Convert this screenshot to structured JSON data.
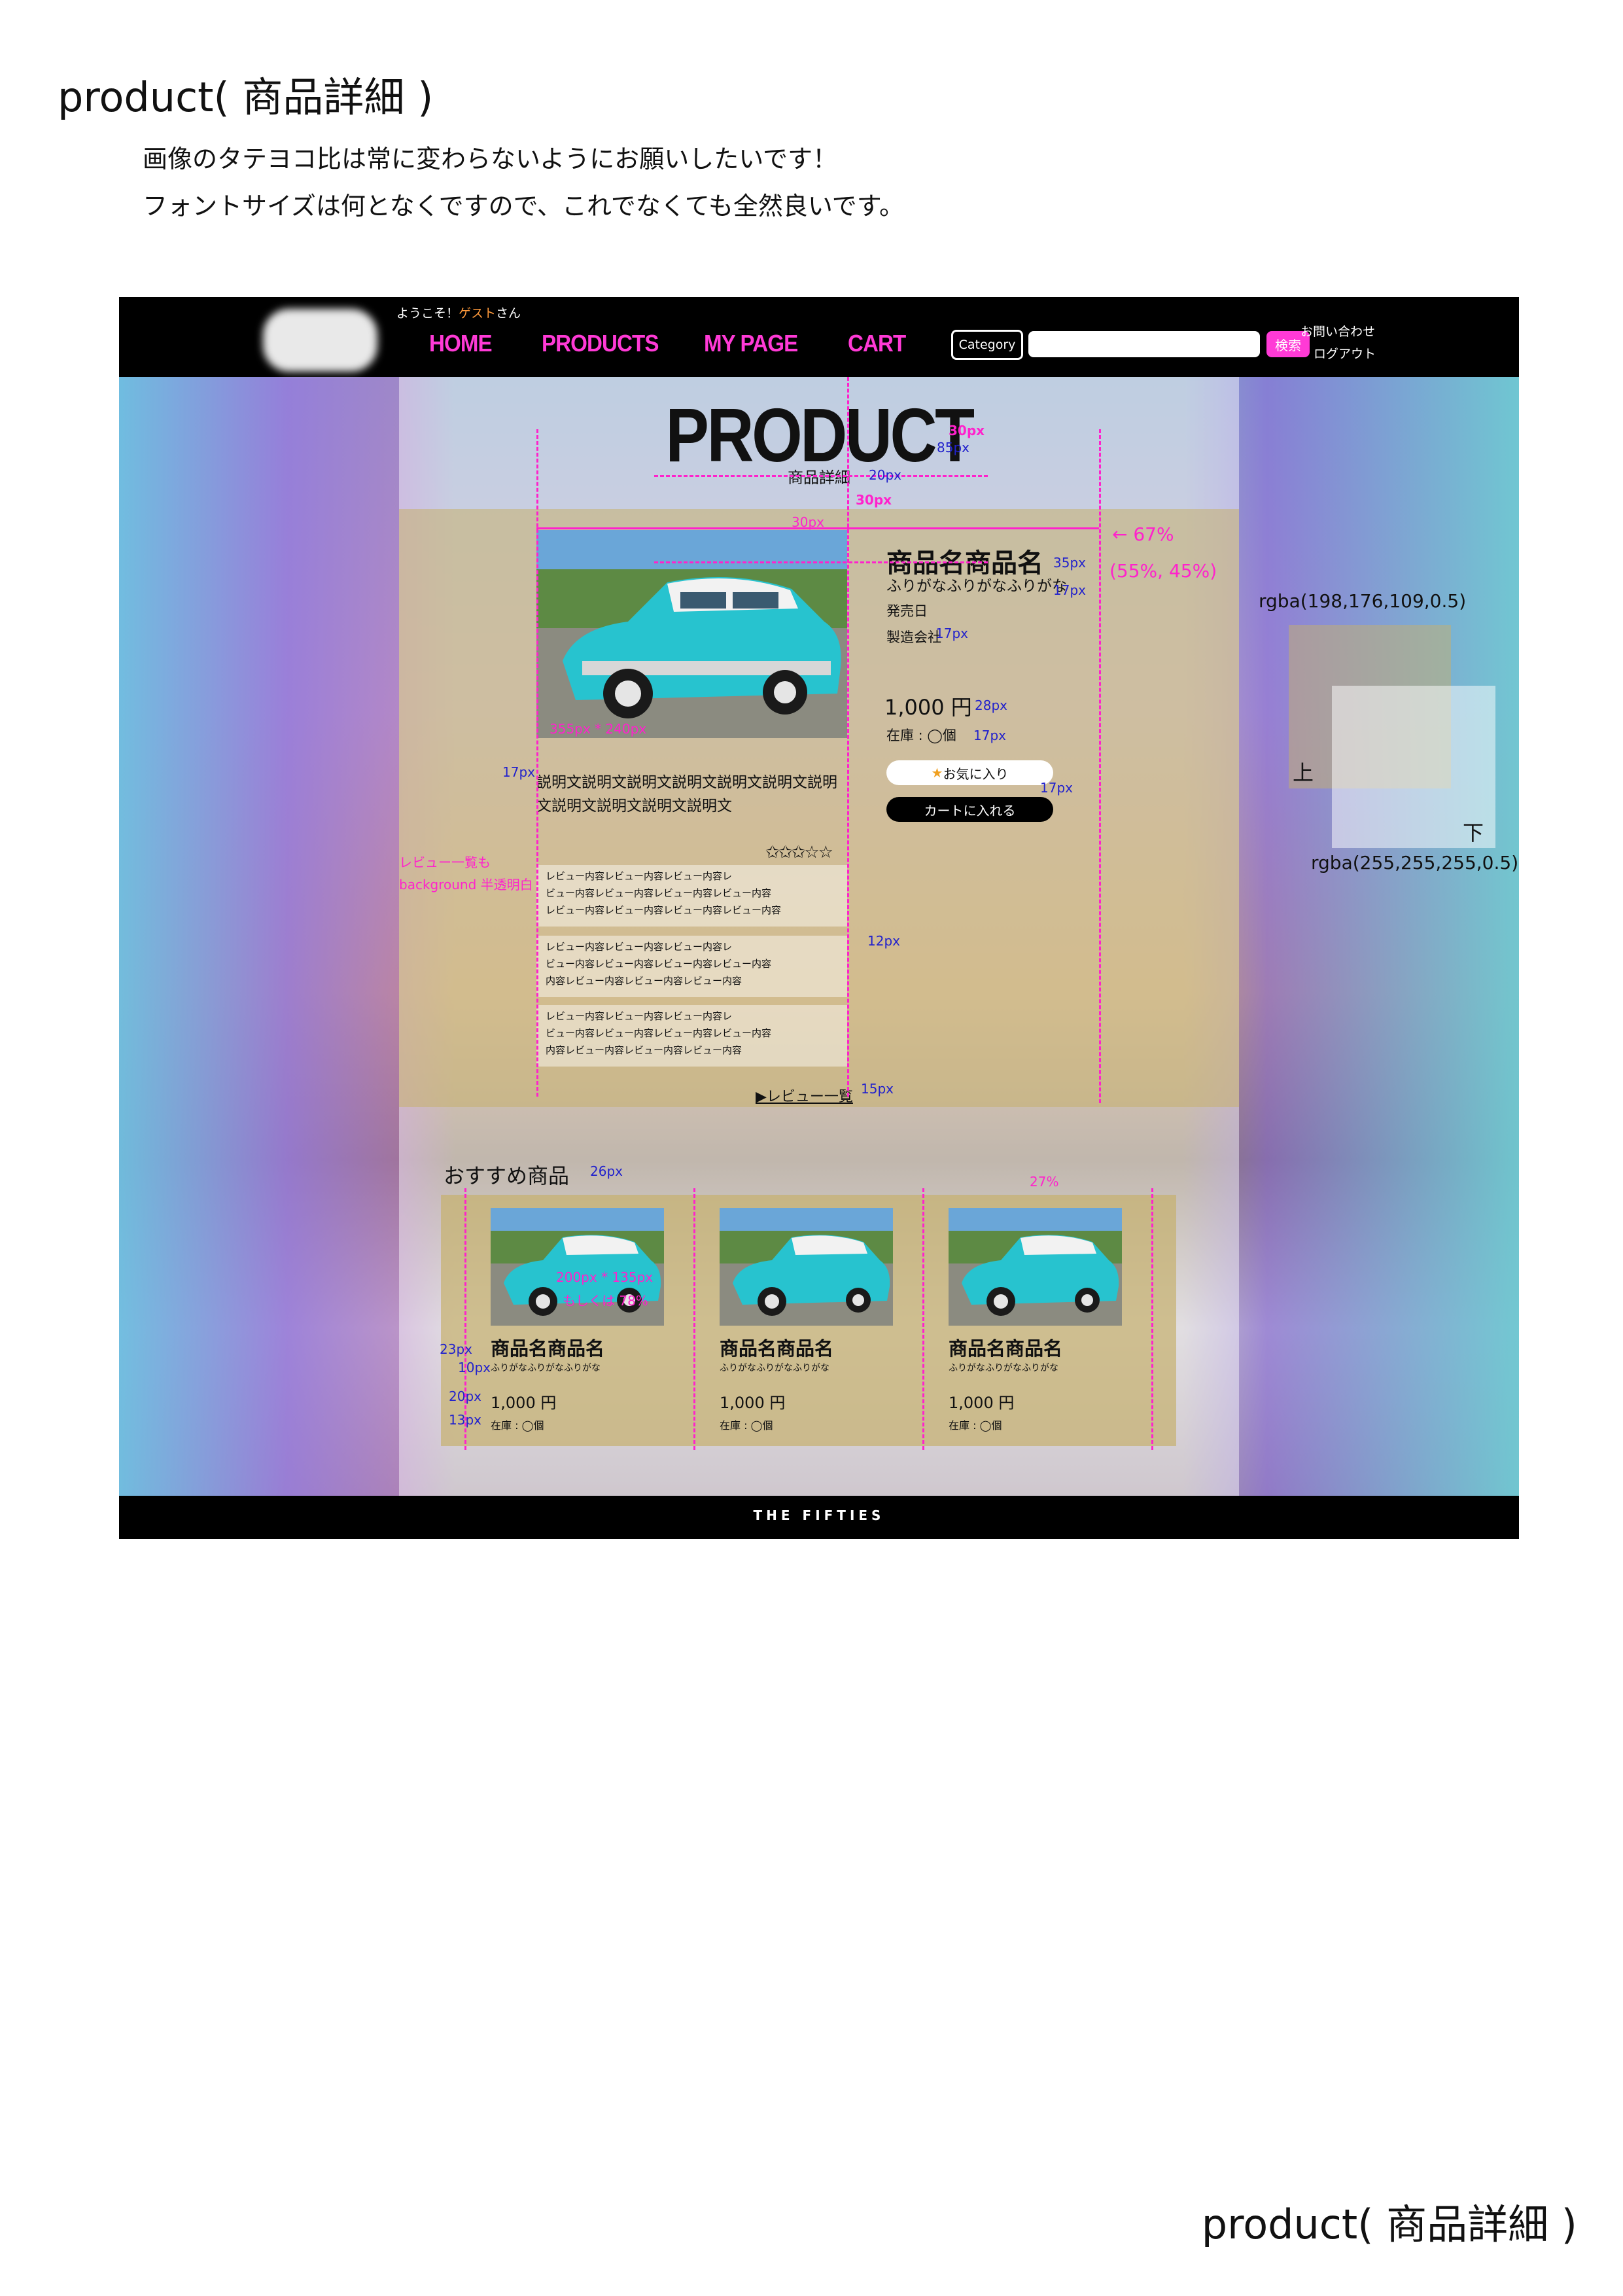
{
  "doc": {
    "title": "product( 商品詳細 )",
    "note1": "画像のタテヨコ比は常に変わらないようにお願いしたいです！",
    "note2": "フォントサイズは何となくですので、これでなくても全然良いです。",
    "footer_title": "product( 商品詳細 )"
  },
  "header": {
    "welcome_prefix": "ようこそ！",
    "welcome_guest": "ゲスト",
    "welcome_suffix": "さん",
    "nav": [
      "HOME",
      "PRODUCTS",
      "MY PAGE",
      "CART"
    ],
    "category_label": "Category",
    "search_value": "",
    "search_button": "検索",
    "contact": "お問い合わせ",
    "logout": "ログアウト"
  },
  "page": {
    "title": "PRODUCT",
    "subtitle": "商品詳細"
  },
  "product": {
    "name": "商品名商品名",
    "kana": "ふりがなふりがなふりがな",
    "release": "発売日",
    "maker": "製造会社",
    "price": "1,000 円",
    "stock": "在庫 : ◯個",
    "fav_button": "お気に入り",
    "fav_star": "★",
    "cart_button": "カートに入れる",
    "description": "説明文説明文説明文説明文説明文説明文説明文説明文説明文説明文説明文",
    "rating_stars": "☆☆☆☆☆",
    "rating": 3
  },
  "reviews": {
    "items": [
      {
        "lines": [
          "レビュー内容レビュー内容レビュー内容レ",
          "ビュー内容レビュー内容レビュー内容レビュー内容",
          "レビュー内容レビュー内容レビュー内容レビュー内容"
        ]
      },
      {
        "lines": [
          "レビュー内容レビュー内容レビュー内容レ",
          "ビュー内容レビュー内容レビュー内容レビュー内容",
          "内容レビュー内容レビュー内容レビュー内容"
        ]
      },
      {
        "lines": [
          "レビュー内容レビュー内容レビュー内容レ",
          "ビュー内容レビュー内容レビュー内容レビュー内容",
          "内容レビュー内容レビュー内容レビュー内容"
        ]
      }
    ],
    "list_link": "▶レビュー一覧"
  },
  "recommend": {
    "title": "おすすめ商品",
    "items": [
      {
        "name": "商品名商品名",
        "kana": "ふりがなふりがなふりがな",
        "price": "1,000 円",
        "stock": "在庫 : ◯個"
      },
      {
        "name": "商品名商品名",
        "kana": "ふりがなふりがなふりがな",
        "price": "1,000 円",
        "stock": "在庫 : ◯個"
      },
      {
        "name": "商品名商品名",
        "kana": "ふりがなふりがなふりがな",
        "price": "1,000 円",
        "stock": "在庫 : ◯個"
      }
    ]
  },
  "footer": {
    "text": "THE FIFTIES"
  },
  "annotations": {
    "px30": "30px",
    "px85": "85px",
    "px20": "20px",
    "px35": "35px",
    "px17": "17px",
    "px28": "28px",
    "px12": "12px",
    "px15": "15px",
    "px26": "26px",
    "px23": "23px",
    "px10": "10px",
    "px13": "13px",
    "pct67": "← 67%",
    "pct_split": "(55%, 45%)",
    "pct27": "27%",
    "img_size_main": "355px * 240px",
    "img_size_rec1": "200px * 135px",
    "img_size_rec2": "もしくは 78%",
    "review_note1": "レビュー一覧も",
    "review_note2": "background 半透明白",
    "rgba_top": "rgba(198,176,109,0.5)",
    "rgba_bottom": "rgba(255,255,255,0.5)",
    "label_top": "上",
    "label_bottom": "下"
  },
  "colors": {
    "accent_pink": "#ff3ad6",
    "guest_orange": "#ff9a3c",
    "band_gold": "rgba(198,176,109,0.5)",
    "annotation_blue": "#2222cc",
    "annotation_pink": "#ff22cc"
  }
}
